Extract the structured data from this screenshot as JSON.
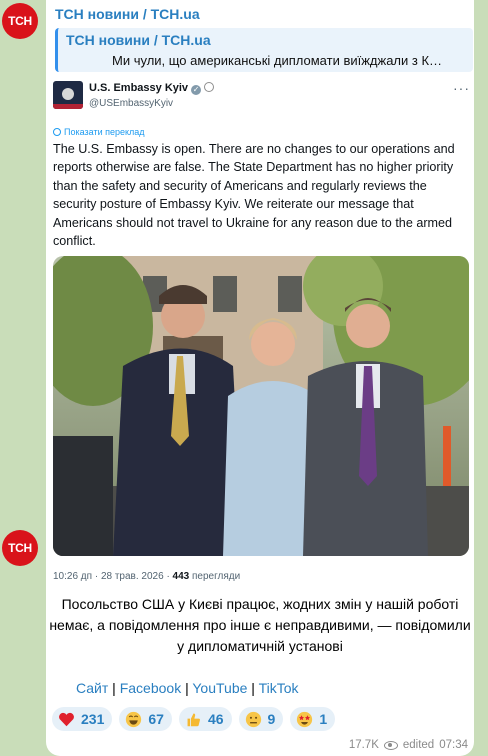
{
  "channel": {
    "avatar_text": "ТСН",
    "name": "ТСН новини / TCH.ua"
  },
  "reply": {
    "title": "ТСН новини / TCH.ua",
    "text": "Ми чули, що американські дипломати виїжджали з К…"
  },
  "tweet": {
    "author": "U.S. Embassy Kyiv",
    "handle": "@USEmbassyKyiv",
    "translate_label": "Показати переклад",
    "text": "The U.S. Embassy is open.  There are no changes to our operations and\nreports otherwise are false. The State Department has no higher priority\nthan the safety and security of Americans and regularly reviews the\nsecurity posture of Embassy Kyiv.  We reiterate our message that\nAmericans should not travel to Ukraine for any reason due to the armed\nconflict.",
    "time": "10:26 дп · 28 трав. 2026 · ",
    "views_count": "443",
    "views_label": " перегляди"
  },
  "caption": "Посольство США у Києві працює, жодних змін у нашій роботі немає, а повідомлення про інше є неправдивими, — повідомили у дипломатичній установі",
  "links": {
    "site": "Сайт",
    "sep1": " | ",
    "facebook": "Facebook",
    "sep2": " | ",
    "youtube": "YouTube",
    "sep3": " | ",
    "tiktok": "TikTok"
  },
  "reactions": [
    {
      "icon": "heart-icon",
      "count": "231"
    },
    {
      "icon": "grin-icon",
      "count": "67"
    },
    {
      "icon": "thumbs-up-icon",
      "count": "46"
    },
    {
      "icon": "neutral-face-icon",
      "count": "9"
    },
    {
      "icon": "star-struck-icon",
      "count": "1"
    }
  ],
  "footer": {
    "views": "17.7K",
    "edited": "edited",
    "time": "07:34"
  },
  "colors": {
    "background": "#c9ddb9",
    "accent": "#2a7fc0",
    "avatar": "#d9131a"
  }
}
